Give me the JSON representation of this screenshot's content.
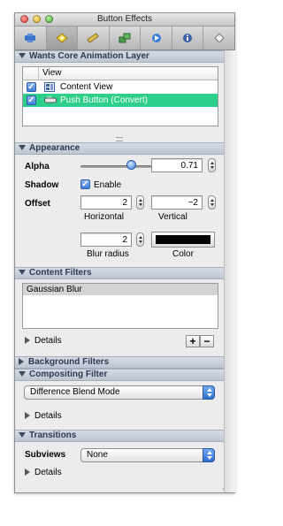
{
  "window": {
    "title": "Button Effects"
  },
  "toolbar": {
    "tabs": [
      {
        "icon": "attributes-inspector-icon"
      },
      {
        "icon": "effects-inspector-icon",
        "selected": true
      },
      {
        "icon": "size-inspector-icon"
      },
      {
        "icon": "bindings-inspector-icon"
      },
      {
        "icon": "connections-inspector-icon"
      },
      {
        "icon": "identity-inspector-icon"
      },
      {
        "icon": "applescript-inspector-icon"
      }
    ]
  },
  "layer": {
    "section_title": "Wants Core Animation Layer",
    "column_header": "View",
    "rows": [
      {
        "label": "Content View",
        "checked": true,
        "selected": false
      },
      {
        "label": "Push Button (Convert)",
        "checked": true,
        "selected": true
      }
    ]
  },
  "appearance": {
    "section_title": "Appearance",
    "alpha_label": "Alpha",
    "alpha_value": "0.71",
    "alpha_slider_fraction": 0.71,
    "shadow_label": "Shadow",
    "shadow_enable_label": "Enable",
    "offset_label": "Offset",
    "offset_horizontal": "2",
    "offset_vertical": "−2",
    "horizontal_caption": "Horizontal",
    "vertical_caption": "Vertical",
    "blur_radius_value": "2",
    "blur_radius_caption": "Blur radius",
    "color_caption": "Color",
    "shadow_color": "#000000"
  },
  "content_filters": {
    "section_title": "Content Filters",
    "items": [
      "Gaussian Blur"
    ],
    "details_label": "Details",
    "add_label": "+",
    "remove_label": "−"
  },
  "background_filters": {
    "section_title": "Background Filters"
  },
  "compositing": {
    "section_title": "Compositing Filter",
    "selected": "Difference Blend Mode",
    "details_label": "Details"
  },
  "transitions": {
    "section_title": "Transitions",
    "subviews_label": "Subviews",
    "subviews_value": "None",
    "details_label": "Details"
  },
  "colors": {
    "selection": "#2ecf8a",
    "accent": "#3f7fdc"
  }
}
